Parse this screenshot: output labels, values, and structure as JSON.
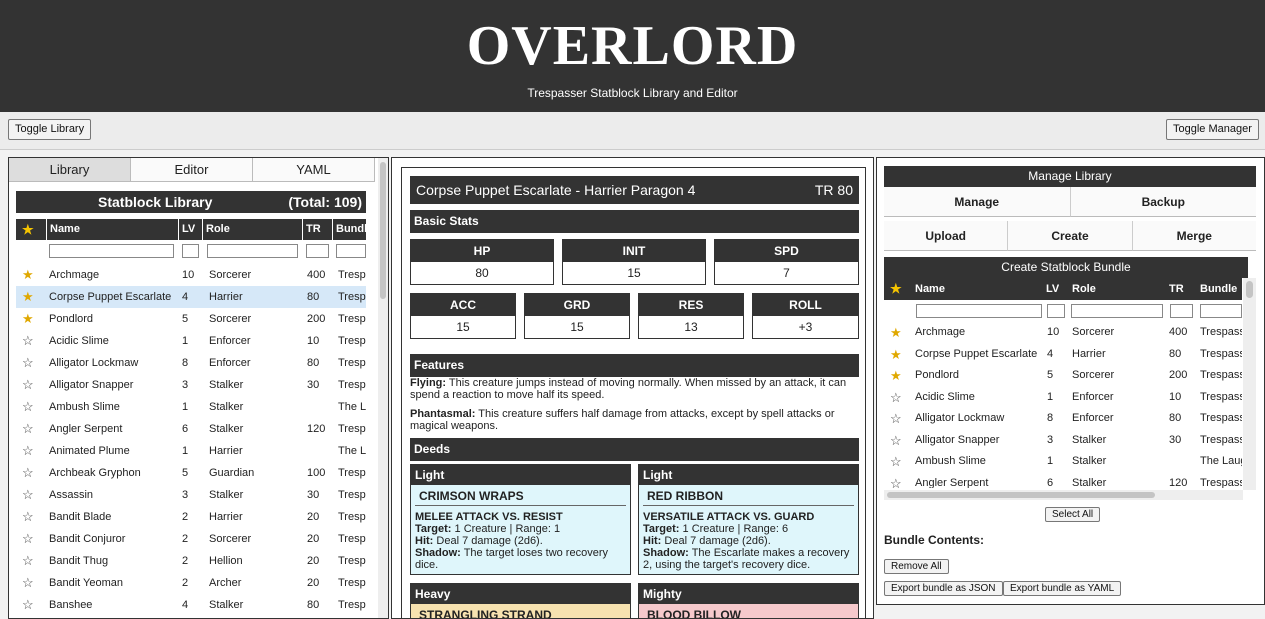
{
  "header": {
    "title": "OVERLORD",
    "subtitle": "Trespasser Statblock Library and Editor"
  },
  "toggles": {
    "library": "Toggle Library",
    "manager": "Toggle Manager"
  },
  "left": {
    "tabs": [
      "Library",
      "Editor",
      "YAML"
    ],
    "library_title": "Statblock Library",
    "total": "(Total: 109)",
    "columns": {
      "star": "★",
      "name": "Name",
      "lv": "LV",
      "role": "Role",
      "tr": "TR",
      "bundle": "Bundle"
    },
    "rows": [
      {
        "fav": true,
        "name": "Archmage",
        "lv": "10",
        "role": "Sorcerer",
        "tr": "400",
        "bundle": "Trespasser"
      },
      {
        "fav": true,
        "name": "Corpse Puppet Escarlate",
        "lv": "4",
        "role": "Harrier",
        "tr": "80",
        "bundle": "Trespasser"
      },
      {
        "fav": true,
        "name": "Pondlord",
        "lv": "5",
        "role": "Sorcerer",
        "tr": "200",
        "bundle": "Trespasser"
      },
      {
        "fav": false,
        "name": "Acidic Slime",
        "lv": "1",
        "role": "Enforcer",
        "tr": "10",
        "bundle": "Trespasser"
      },
      {
        "fav": false,
        "name": "Alligator Lockmaw",
        "lv": "8",
        "role": "Enforcer",
        "tr": "80",
        "bundle": "Trespasser"
      },
      {
        "fav": false,
        "name": "Alligator Snapper",
        "lv": "3",
        "role": "Stalker",
        "tr": "30",
        "bundle": "Trespasser"
      },
      {
        "fav": false,
        "name": "Ambush Slime",
        "lv": "1",
        "role": "Stalker",
        "tr": "",
        "bundle": "The Laughing"
      },
      {
        "fav": false,
        "name": "Angler Serpent",
        "lv": "6",
        "role": "Stalker",
        "tr": "120",
        "bundle": "Trespasser"
      },
      {
        "fav": false,
        "name": "Animated Plume",
        "lv": "1",
        "role": "Harrier",
        "tr": "",
        "bundle": "The Laughing"
      },
      {
        "fav": false,
        "name": "Archbeak Gryphon",
        "lv": "5",
        "role": "Guardian",
        "tr": "100",
        "bundle": "Trespasser"
      },
      {
        "fav": false,
        "name": "Assassin",
        "lv": "3",
        "role": "Stalker",
        "tr": "30",
        "bundle": "Trespasser"
      },
      {
        "fav": false,
        "name": "Bandit Blade",
        "lv": "2",
        "role": "Harrier",
        "tr": "20",
        "bundle": "Trespasser"
      },
      {
        "fav": false,
        "name": "Bandit Conjuror",
        "lv": "2",
        "role": "Sorcerer",
        "tr": "20",
        "bundle": "Trespasser"
      },
      {
        "fav": false,
        "name": "Bandit Thug",
        "lv": "2",
        "role": "Hellion",
        "tr": "20",
        "bundle": "Trespasser"
      },
      {
        "fav": false,
        "name": "Bandit Yeoman",
        "lv": "2",
        "role": "Archer",
        "tr": "20",
        "bundle": "Trespasser"
      },
      {
        "fav": false,
        "name": "Banshee",
        "lv": "4",
        "role": "Stalker",
        "tr": "80",
        "bundle": "Trespasser"
      }
    ]
  },
  "statblock": {
    "title": "Corpse Puppet Escarlate - Harrier Paragon 4",
    "tr": "TR 80",
    "basic_stats": "Basic Stats",
    "stats_row1": [
      {
        "label": "HP",
        "value": "80"
      },
      {
        "label": "INIT",
        "value": "15"
      },
      {
        "label": "SPD",
        "value": "7"
      }
    ],
    "stats_row2": [
      {
        "label": "ACC",
        "value": "15"
      },
      {
        "label": "GRD",
        "value": "15"
      },
      {
        "label": "RES",
        "value": "13"
      },
      {
        "label": "ROLL",
        "value": "+3"
      }
    ],
    "features_title": "Features",
    "features": [
      {
        "name": "Flying:",
        "text": " This creature jumps instead of moving normally. When missed by an attack, it can spend a reaction to move half its speed."
      },
      {
        "name": "Phantasmal:",
        "text": " This creature suffers half damage from attacks, except by spell attacks or magical weapons."
      }
    ],
    "deeds_title": "Deeds",
    "deeds": [
      {
        "tier": "Light",
        "name": "CRIMSON WRAPS",
        "attack": "MELEE ATTACK VS. RESIST",
        "target_label": "Target:",
        "target": " 1 Creature | Range: 1",
        "hit_label": "Hit:",
        "hit": " Deal 7 damage (2d6).",
        "shadow_label": "Shadow:",
        "shadow": " The target loses two recovery dice."
      },
      {
        "tier": "Light",
        "name": "RED RIBBON",
        "attack": "VERSATILE ATTACK VS. GUARD",
        "target_label": "Target:",
        "target": " 1 Creature | Range: 6",
        "hit_label": "Hit:",
        "hit": " Deal 7 damage (2d6).",
        "shadow_label": "Shadow:",
        "shadow": " The Escarlate makes a recovery 2, using the target's recovery dice."
      },
      {
        "tier": "Heavy",
        "name": "STRANGLING STRAND"
      },
      {
        "tier": "Mighty",
        "name": "BLOOD BILLOW"
      }
    ]
  },
  "manager": {
    "title": "Manage Library",
    "tabs": [
      "Manage",
      "Backup"
    ],
    "actions": [
      "Upload",
      "Create",
      "Merge"
    ],
    "bundle_title": "Create Statblock Bundle",
    "columns": {
      "star": "★",
      "name": "Name",
      "lv": "LV",
      "role": "Role",
      "tr": "TR",
      "bundle": "Bundle"
    },
    "rows": [
      {
        "fav": true,
        "name": "Archmage",
        "lv": "10",
        "role": "Sorcerer",
        "tr": "400",
        "bundle": "Trespasser"
      },
      {
        "fav": true,
        "name": "Corpse Puppet Escarlate",
        "lv": "4",
        "role": "Harrier",
        "tr": "80",
        "bundle": "Trespasser"
      },
      {
        "fav": true,
        "name": "Pondlord",
        "lv": "5",
        "role": "Sorcerer",
        "tr": "200",
        "bundle": "Trespasser"
      },
      {
        "fav": false,
        "name": "Acidic Slime",
        "lv": "1",
        "role": "Enforcer",
        "tr": "10",
        "bundle": "Trespasser"
      },
      {
        "fav": false,
        "name": "Alligator Lockmaw",
        "lv": "8",
        "role": "Enforcer",
        "tr": "80",
        "bundle": "Trespasser"
      },
      {
        "fav": false,
        "name": "Alligator Snapper",
        "lv": "3",
        "role": "Stalker",
        "tr": "30",
        "bundle": "Trespasser"
      },
      {
        "fav": false,
        "name": "Ambush Slime",
        "lv": "1",
        "role": "Stalker",
        "tr": "",
        "bundle": "The Laughing"
      },
      {
        "fav": false,
        "name": "Angler Serpent",
        "lv": "6",
        "role": "Stalker",
        "tr": "120",
        "bundle": "Trespasser"
      }
    ],
    "select_all": "Select All",
    "bundle_contents": "Bundle Contents:",
    "remove_all": "Remove All",
    "export_json": "Export bundle as JSON",
    "export_yaml": "Export bundle as YAML"
  },
  "colors": {
    "dark": "#333333",
    "light_deed": "#dff6fb",
    "heavy_deed": "#f7e2b0",
    "mighty_deed": "#f6c9cc",
    "selected_row": "#d6e8f8",
    "star_gold": "#e0a800"
  }
}
